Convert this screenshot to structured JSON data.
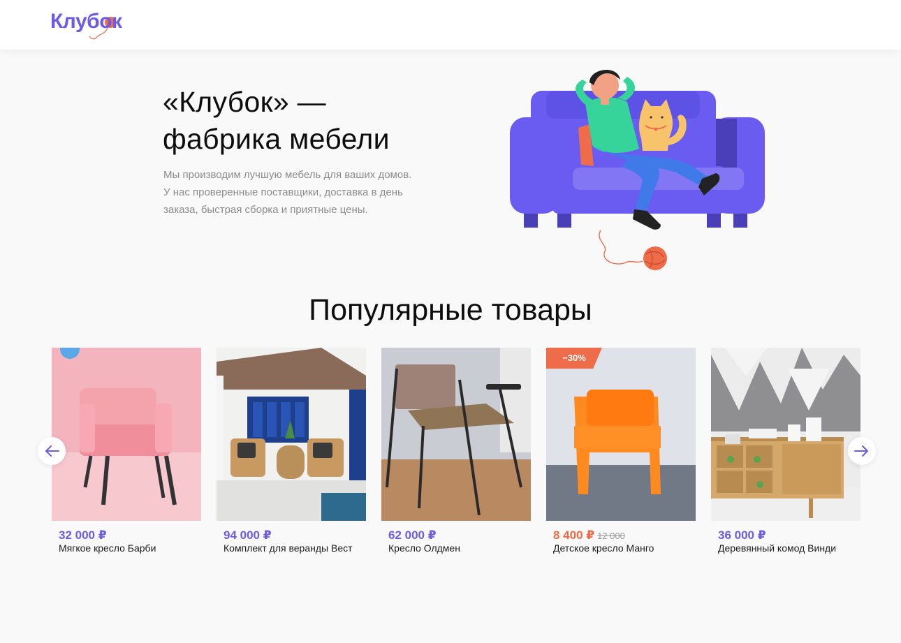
{
  "header": {
    "logo_text": "Клубок"
  },
  "hero": {
    "title_line1": "«Клубок» —",
    "title_line2": "фабрика мебели",
    "text_line1": "Мы производим лучшую мебель для ваших домов.",
    "text_line2": "У нас проверенные поставщики, доставка в день",
    "text_line3": "заказа, быстрая сборка и приятные цены."
  },
  "popular": {
    "title": "Популярные товары",
    "items": [
      {
        "price": "32 000 ₽",
        "name": "Мягкое кресло Барби"
      },
      {
        "price": "94 000 ₽",
        "name": "Комплект для веранды Вест"
      },
      {
        "price": "62 000 ₽",
        "name": "Кресло Олдмен"
      },
      {
        "price": "8 400 ₽",
        "old_price": "12 000",
        "badge": "−30%",
        "name": "Детское кресло Манго"
      },
      {
        "price": "36 000 ₽",
        "name": "Деревянный комод Винди"
      }
    ]
  },
  "colors": {
    "brand": "#6b5ce7",
    "sale": "#ee6a44",
    "background": "#f9f9f9"
  },
  "icons": {
    "prev": "arrow-left-icon",
    "next": "arrow-right-icon"
  }
}
